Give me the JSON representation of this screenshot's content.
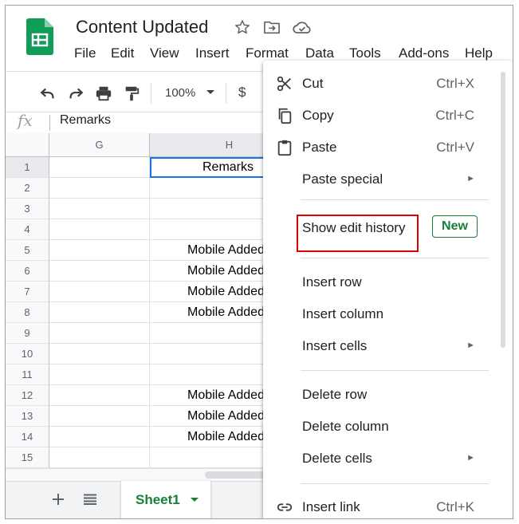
{
  "doc": {
    "title": "Content Updated"
  },
  "menubar": [
    "File",
    "Edit",
    "View",
    "Insert",
    "Format",
    "Data",
    "Tools",
    "Add-ons",
    "Help"
  ],
  "toolbar": {
    "zoom": "100%",
    "currency": "$"
  },
  "formula": {
    "fx": "fx",
    "value": "Remarks"
  },
  "columns": [
    "G",
    "H"
  ],
  "rows": [
    {
      "n": "1",
      "h": "Remarks"
    },
    {
      "n": "2",
      "h": ""
    },
    {
      "n": "3",
      "h": ""
    },
    {
      "n": "4",
      "h": ""
    },
    {
      "n": "5",
      "h": "Mobile Added"
    },
    {
      "n": "6",
      "h": "Mobile Added"
    },
    {
      "n": "7",
      "h": "Mobile Added"
    },
    {
      "n": "8",
      "h": "Mobile Added"
    },
    {
      "n": "9",
      "h": ""
    },
    {
      "n": "10",
      "h": ""
    },
    {
      "n": "11",
      "h": ""
    },
    {
      "n": "12",
      "h": "Mobile Added"
    },
    {
      "n": "13",
      "h": "Mobile Added"
    },
    {
      "n": "14",
      "h": "Mobile Added"
    },
    {
      "n": "15",
      "h": ""
    }
  ],
  "sheets": {
    "active": "Sheet1"
  },
  "context_menu": {
    "cut": {
      "label": "Cut",
      "shortcut": "Ctrl+X"
    },
    "copy": {
      "label": "Copy",
      "shortcut": "Ctrl+C"
    },
    "paste": {
      "label": "Paste",
      "shortcut": "Ctrl+V"
    },
    "paste_special": {
      "label": "Paste special"
    },
    "show_edit_history": {
      "label": "Show edit history",
      "badge": "New"
    },
    "insert_row": {
      "label": "Insert row"
    },
    "insert_column": {
      "label": "Insert column"
    },
    "insert_cells": {
      "label": "Insert cells"
    },
    "delete_row": {
      "label": "Delete row"
    },
    "delete_column": {
      "label": "Delete column"
    },
    "delete_cells": {
      "label": "Delete cells"
    },
    "insert_link": {
      "label": "Insert link",
      "shortcut": "Ctrl+K"
    }
  },
  "colors": {
    "sheets_green": "#0f9d58",
    "highlight_red": "#e00000",
    "badge_green": "#188038",
    "selection_blue": "#1a73e8"
  }
}
